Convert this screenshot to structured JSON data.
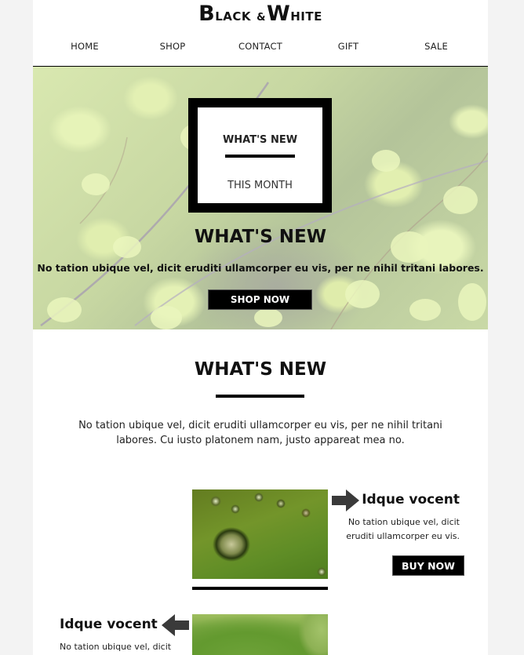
{
  "brand": {
    "logo_b": "B",
    "logo_lack": "LACK",
    "logo_amp": "&",
    "logo_w": "W",
    "logo_hite": "HITE"
  },
  "nav": {
    "items": [
      {
        "label": "HOME"
      },
      {
        "label": "SHOP"
      },
      {
        "label": "CONTACT"
      },
      {
        "label": "GIFT"
      },
      {
        "label": "SALE"
      }
    ]
  },
  "hero": {
    "badge_title": "WHAT'S NEW",
    "badge_subtitle": "THIS MONTH",
    "title": "WHAT'S NEW",
    "text": "No tation ubique vel, dicit eruditi ullamcorper eu vis, per ne nihil tritani labores.",
    "button_label": "SHOP NOW"
  },
  "section": {
    "title": "WHAT'S NEW",
    "text": "No tation ubique vel, dicit eruditi ullamcorper eu vis, per ne nihil tritani labores. Cu iusto platonem nam, justo appareat mea no."
  },
  "products": [
    {
      "title": "Idque vocent",
      "text": "No tation ubique vel, dicit eruditi ullamcorper eu vis.",
      "button_label": "BUY NOW",
      "arrow": "arrow-right-icon"
    },
    {
      "title": "Idque vocent",
      "text": "No tation ubique vel, dicit",
      "arrow": "arrow-left-icon"
    }
  ],
  "colors": {
    "page_bg": "#f3f3f3",
    "content_bg": "#ffffff",
    "accent": "#000000",
    "arrow": "#3a3a3a"
  }
}
